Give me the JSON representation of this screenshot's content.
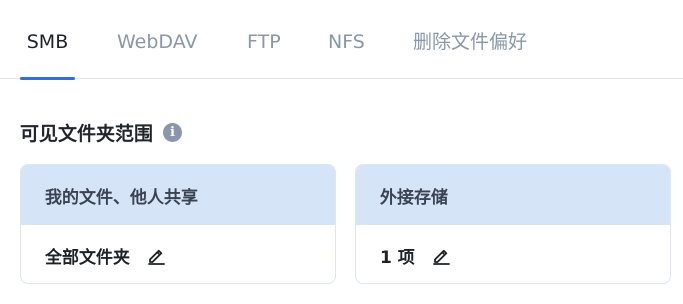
{
  "tabs": [
    {
      "label": "SMB",
      "active": true
    },
    {
      "label": "WebDAV",
      "active": false
    },
    {
      "label": "FTP",
      "active": false
    },
    {
      "label": "NFS",
      "active": false
    },
    {
      "label": "删除文件偏好",
      "active": false
    }
  ],
  "section": {
    "title": "可见文件夹范围",
    "info_icon": "info-icon"
  },
  "cards": [
    {
      "header": "我的文件、他人共享",
      "value": "全部文件夹",
      "edit_icon": "pencil-icon"
    },
    {
      "header": "外接存储",
      "value": "1 项",
      "edit_icon": "pencil-icon"
    }
  ],
  "colors": {
    "accent": "#2f6fd6",
    "card_header_bg": "#d6e4f7",
    "inactive_tab": "#8a97ab"
  }
}
